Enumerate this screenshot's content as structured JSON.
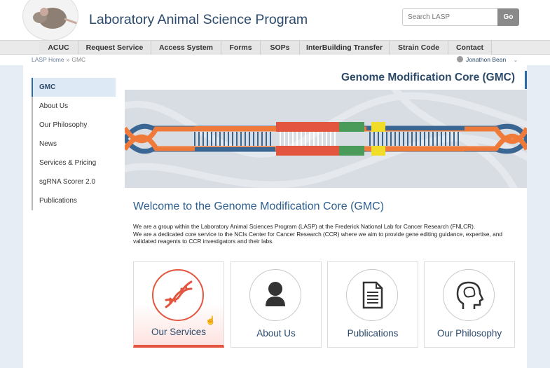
{
  "header": {
    "site_title": "Laboratory Animal Science Program",
    "search_placeholder": "Search LASP",
    "search_button": "Go"
  },
  "nav": {
    "items": [
      "ACUC",
      "Request Service",
      "Access System",
      "Forms",
      "SOPs",
      "InterBuilding Transfer",
      "Strain Code",
      "Contact"
    ]
  },
  "breadcrumb": {
    "home": "LASP Home",
    "separator": "»",
    "current": "GMC"
  },
  "user": {
    "name": "Jonathon Bean",
    "caret": "⌄"
  },
  "sidebar": {
    "items": [
      "GMC",
      "About Us",
      "Our Philosophy",
      "News",
      "Services & Pricing",
      "sgRNA Scorer 2.0",
      "Publications"
    ]
  },
  "page_title": "Genome Modification Core (GMC)",
  "welcome": {
    "heading": "Welcome to the Genome Modification Core (GMC)",
    "line1": "We are a group within the Laboratory Animal Sciences Program (LASP) at the Frederick National Lab for Cancer Research (FNLCR).",
    "line2": "We are a dedicated core service to the NCIs Center for Cancer Research (CCR) where we aim to provide gene editing guidance, expertise, and validated reagents to CCR investigators and their labs."
  },
  "cards": [
    {
      "label": "Our Services",
      "icon": "dna-icon"
    },
    {
      "label": "About Us",
      "icon": "person-icon"
    },
    {
      "label": "Publications",
      "icon": "document-icon"
    },
    {
      "label": "Our Philosophy",
      "icon": "brain-head-icon"
    }
  ],
  "colors": {
    "accent": "#2c6aa8",
    "title": "#2c4a6b",
    "highlight": "#e4553f",
    "dna_orange": "#f07a3a",
    "dna_blue": "#3a6694"
  }
}
